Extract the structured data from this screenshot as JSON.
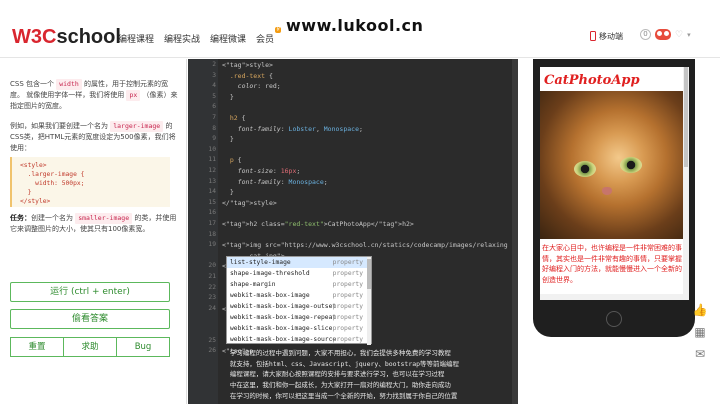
{
  "header": {
    "logo_a": "W3C",
    "logo_b": "school",
    "nav": [
      "编程课程",
      "编程实战",
      "编程微课",
      "会员"
    ],
    "nav_badge": "¥",
    "watermark": "www.lukool.cn",
    "mobile": "移动端",
    "counter": "0"
  },
  "lesson": {
    "p1": [
      "CSS 包含一个",
      "width",
      "的属性，用于控制元素的宽度。 就像使用字体一样，我们将使用",
      "px",
      "（像素）来指定图片的宽度。"
    ],
    "p2": [
      "例如，如果我们要创建一个名为",
      "larger-image",
      "的CSS类，把HTML元素的宽度设定为500像素，我们将使用："
    ],
    "code": [
      "<style>",
      "  .larger-image {",
      "    width: 500px;",
      "  }",
      "</style>"
    ],
    "task_label": "任务：",
    "task": [
      "创建一个名为",
      "smaller-image",
      "的类，并使用它来调整图片的大小，使其只有100像素宽。"
    ]
  },
  "buttons": {
    "run": "运行 (ctrl + enter)",
    "answer": "偷看答案",
    "reset": "重置",
    "help": "求助",
    "bug": "Bug"
  },
  "editor": {
    "lines": [
      {
        "n": "2",
        "t": "<style>"
      },
      {
        "n": "3",
        "t": "  .red-text {"
      },
      {
        "n": "4",
        "t": "    color: red;"
      },
      {
        "n": "5",
        "t": "  }"
      },
      {
        "n": "6",
        "t": ""
      },
      {
        "n": "7",
        "t": "  h2 {"
      },
      {
        "n": "8",
        "t": "    font-family: Lobster, Monospace;"
      },
      {
        "n": "9",
        "t": "  }"
      },
      {
        "n": "10",
        "t": ""
      },
      {
        "n": "11",
        "t": "  p {"
      },
      {
        "n": "12",
        "t": "    font-size: 16px;"
      },
      {
        "n": "13",
        "t": "    font-family: Monospace;"
      },
      {
        "n": "14",
        "t": "  }"
      },
      {
        "n": "15",
        "t": "</style>"
      },
      {
        "n": "16",
        "t": ""
      },
      {
        "n": "17",
        "t": "<h2 class=\"red-text\">CatPhotoApp</h2>"
      },
      {
        "n": "18",
        "t": ""
      },
      {
        "n": "19",
        "t": "<img src=\"https://www.w3cschool.cn/statics/codecamp/images/relaxing"
      },
      {
        "n": "",
        "t": "      -cat.jpg\">"
      },
      {
        "n": "20",
        "t": "<style>"
      },
      {
        "n": "21",
        "t": "  .sma-image {"
      },
      {
        "n": "22",
        "t": ""
      },
      {
        "n": "23",
        "t": ""
      },
      {
        "n": "24",
        "t": "<p"
      },
      {
        "n": "",
        "t": ""
      },
      {
        "n": "",
        "t": ""
      },
      {
        "n": "25",
        "t": ""
      },
      {
        "n": "26",
        "t": "<p"
      },
      {
        "n": "",
        "t": ""
      },
      {
        "n": "",
        "t": ""
      },
      {
        "n": "",
        "t": ""
      },
      {
        "n": "",
        "t": ""
      }
    ],
    "p24": "                                    要的事情。其实也是一件非常",
    "p24b": "                                    的方法，就能慢慢进入一个全新的创造",
    "p26": "  学习编程的过程中遇到问题，大家不用担心，我们会提供多种免费的学习教程",
    "p26b": "  就支持，包括html、css、Javascript、jquery、bootstrap等等前端编程",
    "p26c": "  编程课程，请大家耐心按照课程的安排与要求进行学习，也可以在学习过程",
    "p26d": "  中在这里，我们和你一起成长，为大家打开一扇对的编程大门，助你走向成功",
    "p26e": "  在学习的时候，你可以把这里当成一个全新的开始，努力找到属于你自己的位置",
    "autocomplete": [
      {
        "name": "list-style-image",
        "kind": "property"
      },
      {
        "name": "shape-image-threshold",
        "kind": "property"
      },
      {
        "name": "shape-margin",
        "kind": "property"
      },
      {
        "name": "webkit-mask-box-image",
        "kind": "property"
      },
      {
        "name": "webkit-mask-box-image-outset",
        "kind": "property"
      },
      {
        "name": "webkit-mask-box-image-repeat",
        "kind": "property"
      },
      {
        "name": "webkit-mask-box-image-slice",
        "kind": "property"
      },
      {
        "name": "webkit-mask-box-image-source",
        "kind": "property"
      }
    ]
  },
  "preview": {
    "title": "CatPhotoApp",
    "text": "在大家心目中，也许编程是一件非常困难的事情，其实也是一件非常有趣的事情，只要掌握好编程入门的方法，就能慢慢进入一个全新的创造世界。"
  },
  "colors": {
    "accent": "#d9262f",
    "green": "#5cb85c",
    "editor_bg": "#2b2b2b",
    "preview_red": "#e02020"
  }
}
